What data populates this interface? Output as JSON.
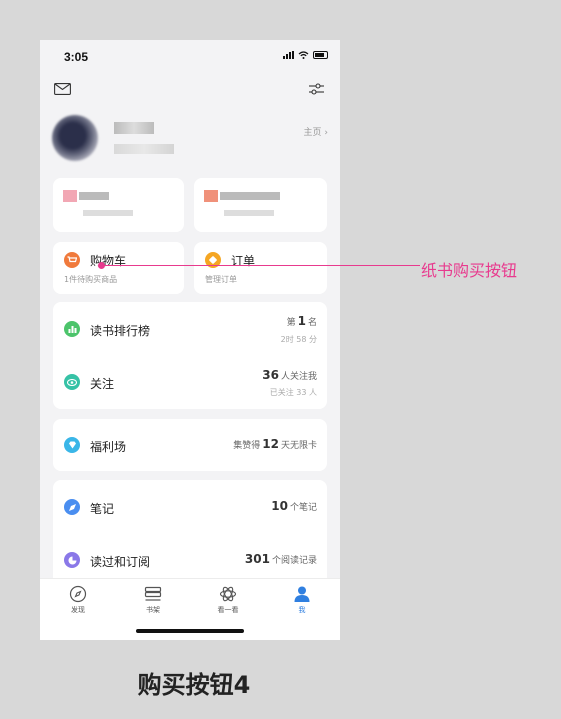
{
  "status_bar": {
    "time": "3:05"
  },
  "profile": {
    "homepage_link": "主页 ›"
  },
  "shopping": {
    "cart": {
      "title": "购物车",
      "subtitle": "1件待购买商品",
      "color": "#f07a3c"
    },
    "order": {
      "title": "订单",
      "subtitle": "管理订单",
      "color": "#f5a623"
    }
  },
  "stats": {
    "ranking": {
      "label": "读书排行榜",
      "prefix": "第",
      "value": "1",
      "suffix": "名",
      "sub": "2时 58 分",
      "color": "#4cc46b"
    },
    "follow": {
      "label": "关注",
      "value": "36",
      "suffix": "人关注我",
      "sub": "已关注 33 人",
      "color": "#36c2a6"
    }
  },
  "welfare": {
    "label": "福利场",
    "prefix": "集赞得",
    "value": "12",
    "suffix": "天无限卡",
    "color": "#3ab6e8"
  },
  "records": {
    "notes": {
      "label": "笔记",
      "value": "10",
      "suffix": "个笔记",
      "color": "#4a8ef0"
    },
    "read": {
      "label": "读过和订阅",
      "value": "301",
      "suffix": "个阅读记录",
      "color": "#8a78e8"
    }
  },
  "tabbar": {
    "tabs": [
      {
        "label": "发现",
        "icon": "compass-icon"
      },
      {
        "label": "书架",
        "icon": "bookshelf-icon"
      },
      {
        "label": "看一看",
        "icon": "explore-icon"
      },
      {
        "label": "我",
        "icon": "profile-icon"
      }
    ],
    "active_color": "#2f7fe0"
  },
  "annotation": {
    "callout_label": "纸书购买按钮",
    "accent": "#e83a8e"
  },
  "caption": "购买按钮4"
}
